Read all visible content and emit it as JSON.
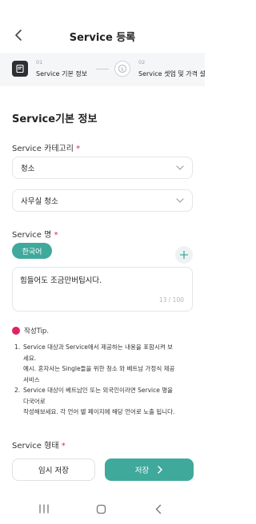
{
  "header": {
    "title": "Service 등록"
  },
  "steps": [
    {
      "num": "01",
      "label": "Service 기본 정보",
      "icon": "document-icon",
      "active": true
    },
    {
      "num": "02",
      "label": "Service 셋업 및 가격 설",
      "icon": "dollar-icon",
      "active": false
    }
  ],
  "section": {
    "title": "Service기본 정보"
  },
  "category": {
    "label": "Service 카테고리",
    "required_mark": "*",
    "primary_value": "청소",
    "secondary_value": "사무실 청소"
  },
  "service_name": {
    "label": "Service 명",
    "required_mark": "*",
    "language_tab": "한국어",
    "value": "힘들어도 조금만버팁시다.",
    "counter": "13 / 100"
  },
  "tip": {
    "title": "작성Tip.",
    "items": [
      {
        "num": "1.",
        "lines": [
          "Service 대상과 Service에서 제공하는 내용을 포함시켜 보",
          "세요.",
          "예시. 혼자사는 Single들을 위한 청소 와 베트남 가정식 제공",
          "서비스"
        ]
      },
      {
        "num": "2.",
        "lines": [
          "Service 대상이 베트남인 또는 외국인이라면 Service 명을",
          "다국어로",
          "작성해보세요. 각 언어 별 페이지에 해당 언어로 노출 됩니다."
        ]
      }
    ]
  },
  "service_type": {
    "label": "Service 형태",
    "required_mark": "*"
  },
  "actions": {
    "temp_save": "임시 저장",
    "save": "저장"
  },
  "colors": {
    "accent": "#3fa99b",
    "required": "#e0245e",
    "step_active": "#2d2f33"
  }
}
